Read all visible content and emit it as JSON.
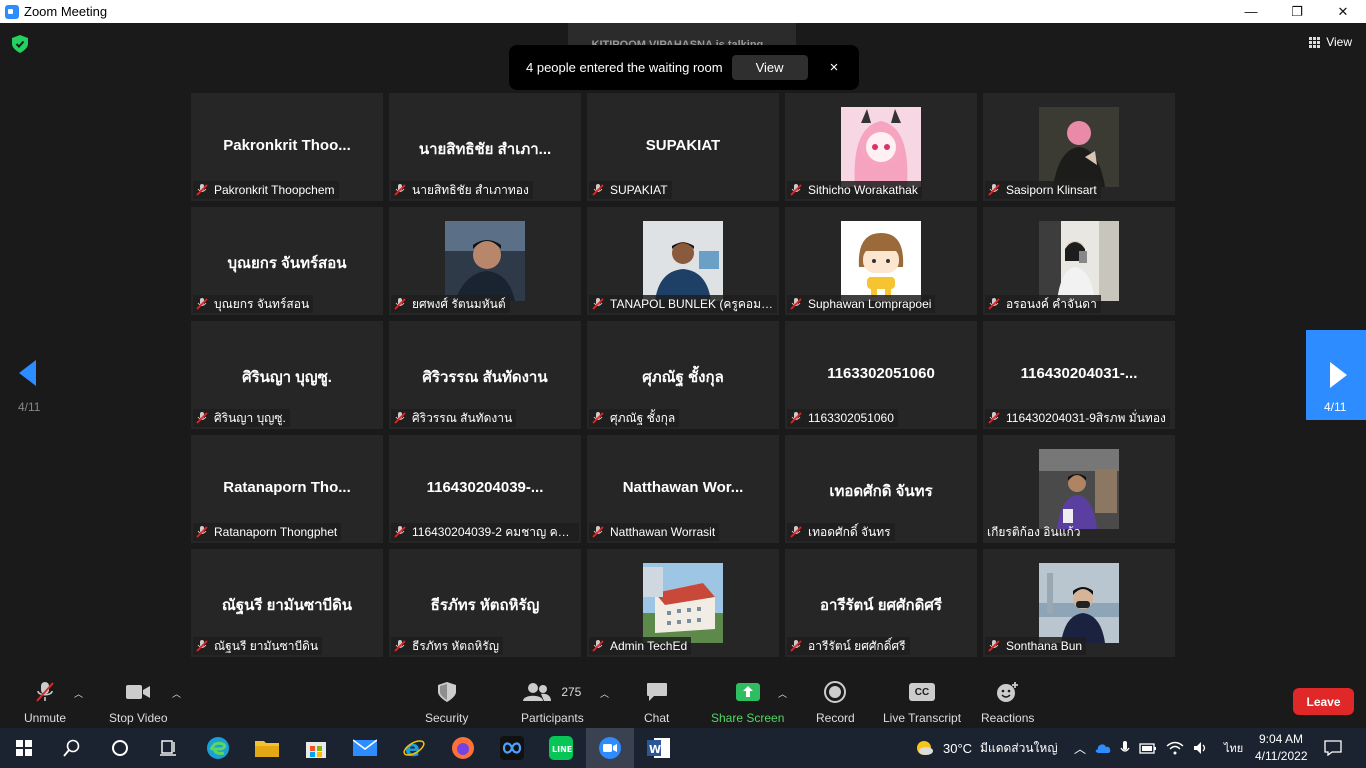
{
  "window": {
    "title": "Zoom Meeting",
    "controls": [
      "—",
      "❐",
      "✕"
    ]
  },
  "header": {
    "talking": "KITIPOOM VIPAHASNA is talking...",
    "view_label": "View"
  },
  "notification": {
    "message": "4 people entered the waiting room",
    "view_button": "View",
    "close": "×"
  },
  "pager": {
    "left": "4/11",
    "right": "4/11"
  },
  "tiles": [
    {
      "big": "Pakronkrit  Thoo...",
      "label": "Pakronkrit Thoopchem"
    },
    {
      "big": "นายสิทธิชัย สำเภา...",
      "label": "นายสิทธิชัย สำเภาทอง"
    },
    {
      "big": "SUPAKIAT",
      "label": "SUPAKIAT"
    },
    {
      "avatar": "anime-girl",
      "label": "Sithicho Worakathak"
    },
    {
      "avatar": "dark-photo",
      "label": "Sasiporn Klinsart"
    },
    {
      "big": "บุณยกร จันทร์สอน",
      "label": "บุณยกร จันทร์สอน"
    },
    {
      "avatar": "selfie-dark",
      "label": "ยศพงศ์ รัตนมหันต์"
    },
    {
      "avatar": "man-office",
      "label": "TANAPOL BUNLEK (ครูคอม62)"
    },
    {
      "avatar": "cartoon-girl",
      "label": "Suphawan Lomprapoei"
    },
    {
      "avatar": "mirror-selfie",
      "label": "อรอนงค์ คำจันดา"
    },
    {
      "big": "ศิรินญา บุญซู.",
      "label": "ศิรินญา บุญซู."
    },
    {
      "big": "ศิริวรรณ สันทัดงาน",
      "label": "ศิริวรรณ สันทัดงาน"
    },
    {
      "big": "ศุภณัฐ ชั้งกุล",
      "label": "ศุภณัฐ ชั้งกุล"
    },
    {
      "big": "1163302051060",
      "label": "1163302051060"
    },
    {
      "big": "116430204031-...",
      "label": "116430204031-9สิรภพ มั่นทอง"
    },
    {
      "big": "Ratanaporn  Tho...",
      "label": "Ratanaporn Thongphet"
    },
    {
      "big": "116430204039-...",
      "label": "116430204039-2 คมชาญ คช..."
    },
    {
      "big": "Natthawan  Wor...",
      "label": "Natthawan Worrasit"
    },
    {
      "big": "เทอดศักดิ จันทร",
      "label": "เทอดศักดิ์ จันทร"
    },
    {
      "avatar": "boy-car",
      "label": "เกียรติก้อง อินแก้ว",
      "nomic": true
    },
    {
      "big": "ณัฐนรี ยามันซาบีดิน",
      "label": "ณัฐนรี ยามันซาบีดิน"
    },
    {
      "big": "ธีรภัทร หัตถหิรัญ",
      "label": "ธีรภัทร หัตถหิรัญ"
    },
    {
      "avatar": "building",
      "label": "Admin TechEd"
    },
    {
      "big": "อารีรัตน์ ยศศักดิศรี",
      "label": "อารีรัตน์ ยศศักดิ์ศรี"
    },
    {
      "avatar": "boy-mask",
      "label": "Sonthana Bun"
    }
  ],
  "toolbar": {
    "unmute": "Unmute",
    "stop_video": "Stop Video",
    "security": "Security",
    "participants": "Participants",
    "participants_count": "275",
    "chat": "Chat",
    "share_screen": "Share Screen",
    "record": "Record",
    "live_transcript": "Live Transcript",
    "reactions": "Reactions",
    "leave": "Leave",
    "cc": "CC"
  },
  "taskbar": {
    "weather": "30°C",
    "weather_text": "มีแดดส่วนใหญ่",
    "lang": "ไทย",
    "time": "9:04 AM",
    "date": "4/11/2022"
  },
  "colors": {
    "accent": "#2d8cff",
    "leave": "#e02828",
    "share": "#2dbe60",
    "mute": "#e02828"
  }
}
